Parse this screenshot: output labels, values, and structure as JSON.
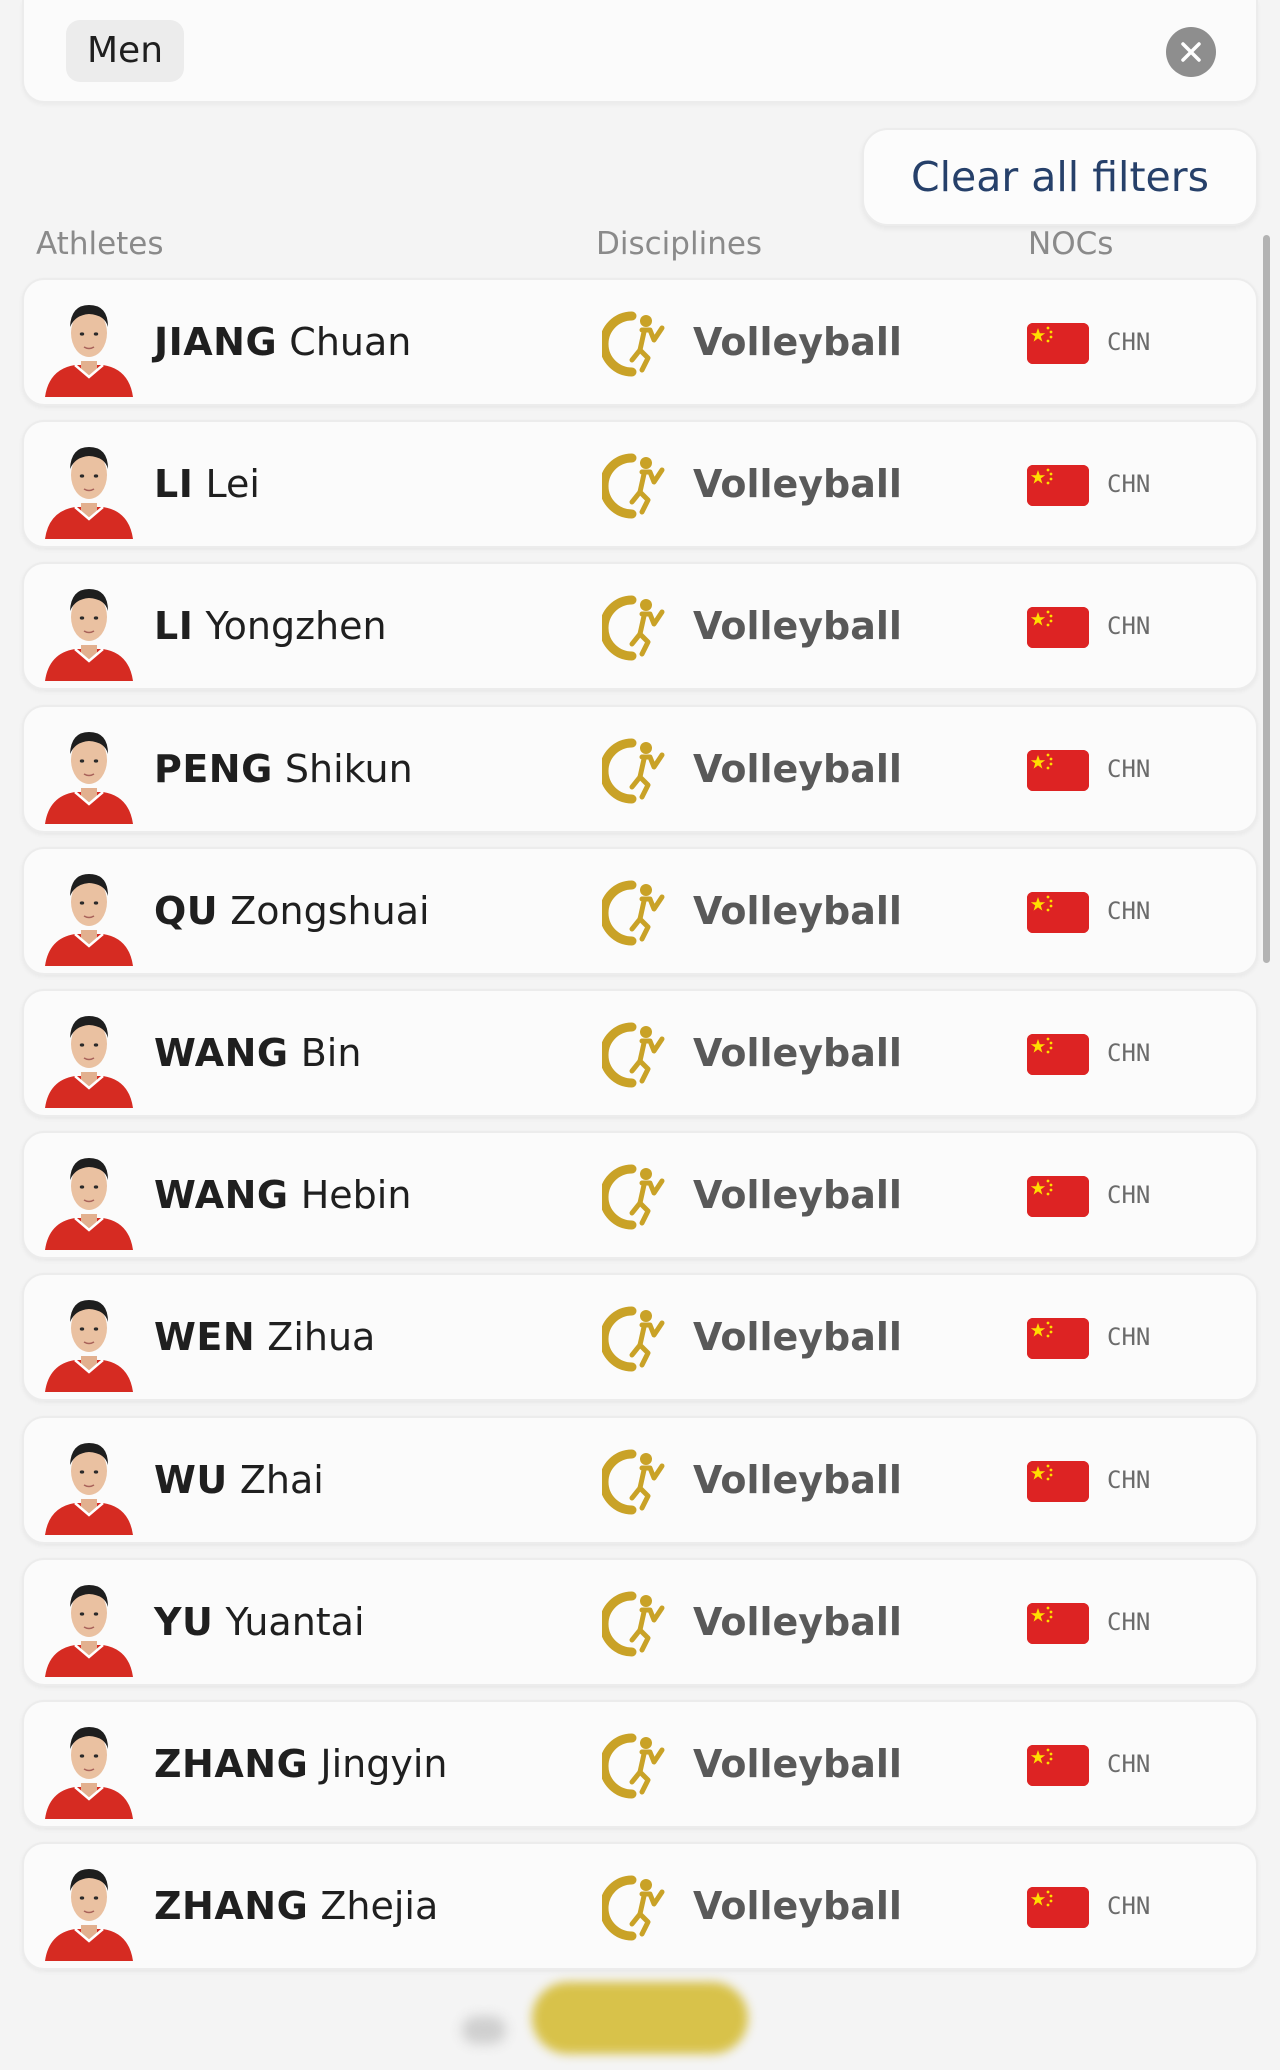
{
  "filter": {
    "chip_label": "Men",
    "close_icon": "close-icon"
  },
  "clear_filters_label": "Clear all filters",
  "columns": {
    "athletes": "Athletes",
    "disciplines": "Disciplines",
    "nocs": "NOCs"
  },
  "colors": {
    "flag_red": "#dd2323",
    "flag_star": "#ffde00",
    "sport_gold": "#c9a227",
    "accent_text": "#26406a"
  },
  "athletes": [
    {
      "surname": "JIANG",
      "given": "Chuan",
      "discipline": "Volleyball",
      "noc": "CHN",
      "flag": "china-flag-icon",
      "sport_icon": "volleyball-icon"
    },
    {
      "surname": "LI",
      "given": "Lei",
      "discipline": "Volleyball",
      "noc": "CHN",
      "flag": "china-flag-icon",
      "sport_icon": "volleyball-icon"
    },
    {
      "surname": "LI",
      "given": "Yongzhen",
      "discipline": "Volleyball",
      "noc": "CHN",
      "flag": "china-flag-icon",
      "sport_icon": "volleyball-icon"
    },
    {
      "surname": "PENG",
      "given": "Shikun",
      "discipline": "Volleyball",
      "noc": "CHN",
      "flag": "china-flag-icon",
      "sport_icon": "volleyball-icon"
    },
    {
      "surname": "QU",
      "given": "Zongshuai",
      "discipline": "Volleyball",
      "noc": "CHN",
      "flag": "china-flag-icon",
      "sport_icon": "volleyball-icon"
    },
    {
      "surname": "WANG",
      "given": "Bin",
      "discipline": "Volleyball",
      "noc": "CHN",
      "flag": "china-flag-icon",
      "sport_icon": "volleyball-icon"
    },
    {
      "surname": "WANG",
      "given": "Hebin",
      "discipline": "Volleyball",
      "noc": "CHN",
      "flag": "china-flag-icon",
      "sport_icon": "volleyball-icon"
    },
    {
      "surname": "WEN",
      "given": "Zihua",
      "discipline": "Volleyball",
      "noc": "CHN",
      "flag": "china-flag-icon",
      "sport_icon": "volleyball-icon"
    },
    {
      "surname": "WU",
      "given": "Zhai",
      "discipline": "Volleyball",
      "noc": "CHN",
      "flag": "china-flag-icon",
      "sport_icon": "volleyball-icon"
    },
    {
      "surname": "YU",
      "given": "Yuantai",
      "discipline": "Volleyball",
      "noc": "CHN",
      "flag": "china-flag-icon",
      "sport_icon": "volleyball-icon"
    },
    {
      "surname": "ZHANG",
      "given": "Jingyin",
      "discipline": "Volleyball",
      "noc": "CHN",
      "flag": "china-flag-icon",
      "sport_icon": "volleyball-icon"
    },
    {
      "surname": "ZHANG",
      "given": "Zhejia",
      "discipline": "Volleyball",
      "noc": "CHN",
      "flag": "china-flag-icon",
      "sport_icon": "volleyball-icon"
    }
  ]
}
